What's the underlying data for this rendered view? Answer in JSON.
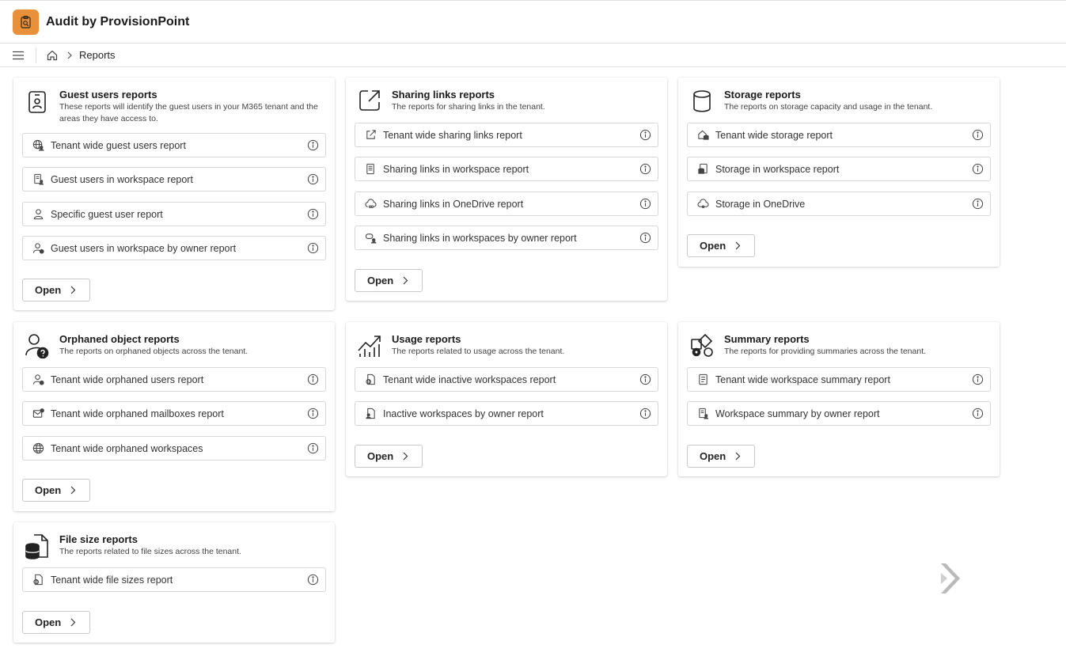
{
  "app": {
    "title": "Audit by ProvisionPoint"
  },
  "breadcrumb": {
    "current": "Reports"
  },
  "cards": {
    "guest": {
      "title": "Guest users reports",
      "description": "These reports will identify the guest users in your M365 tenant and the areas they have access to.",
      "open_label": "Open",
      "items": [
        "Tenant wide guest users report",
        "Guest users in workspace report",
        "Specific guest user report",
        "Guest users in workspace by owner report"
      ]
    },
    "sharing": {
      "title": "Sharing links reports",
      "description": "The reports for sharing links in the tenant.",
      "open_label": "Open",
      "items": [
        "Tenant wide sharing links report",
        "Sharing links in workspace report",
        "Sharing links in OneDrive report",
        "Sharing links in workspaces by owner report"
      ]
    },
    "storage": {
      "title": "Storage reports",
      "description": "The reports on storage capacity and usage in the tenant.",
      "open_label": "Open",
      "items": [
        "Tenant wide storage report",
        "Storage in workspace report",
        "Storage in OneDrive"
      ]
    },
    "orphaned": {
      "title": "Orphaned object reports",
      "description": "The reports on orphaned objects across the tenant.",
      "open_label": "Open",
      "items": [
        "Tenant wide orphaned users report",
        "Tenant wide orphaned mailboxes report",
        "Tenant wide orphaned workspaces"
      ]
    },
    "usage": {
      "title": "Usage reports",
      "description": "The reports related to usage across the tenant.",
      "open_label": "Open",
      "items": [
        "Tenant wide inactive workspaces report",
        "Inactive workspaces by owner report"
      ]
    },
    "summary": {
      "title": "Summary reports",
      "description": "The reports for providing summaries across the tenant.",
      "open_label": "Open",
      "items": [
        "Tenant wide workspace summary report",
        "Workspace summary by owner report"
      ]
    },
    "filesize": {
      "title": "File size reports",
      "description": "The reports related to file sizes across the tenant.",
      "open_label": "Open",
      "items": [
        "Tenant wide file sizes report"
      ]
    }
  },
  "colors": {
    "brand": "#e8913a",
    "border": "#d8d8d8",
    "text": "#242424"
  },
  "icons": [
    "app-logo-icon",
    "hamburger-icon",
    "home-icon",
    "chevron-right-icon",
    "info-icon"
  ]
}
